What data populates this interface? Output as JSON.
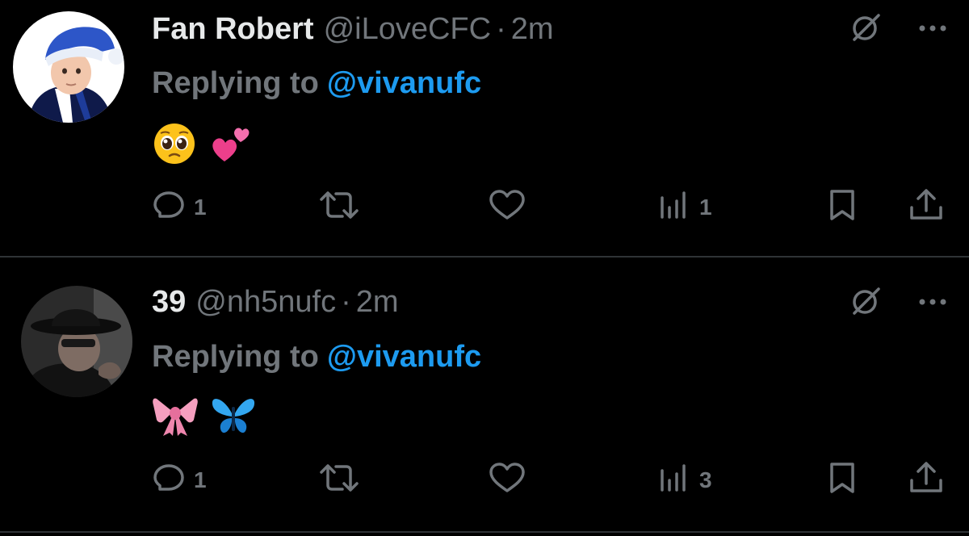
{
  "tweets": [
    {
      "display_name": "Fan Robert",
      "handle": "@iLoveCFC",
      "separator": "·",
      "time": "2m",
      "replying_label": "Replying to",
      "replying_handle": "@vivanufc",
      "emojis": [
        "🥺",
        "💕"
      ],
      "reply_count": "1",
      "view_count": "1",
      "avatar_icon": "child-in-blue-hat-avatar"
    },
    {
      "display_name": "39",
      "handle": "@nh5nufc",
      "separator": "·",
      "time": "2m",
      "replying_label": "Replying to",
      "replying_handle": "@vivanufc",
      "emojis": [
        "🎀",
        "🦋"
      ],
      "reply_count": "1",
      "view_count": "3",
      "avatar_icon": "man-in-black-hat-avatar"
    }
  ],
  "colors": {
    "background": "#000000",
    "primary_text": "#e7e9ea",
    "secondary_text": "#71767b",
    "link": "#1d9bf0",
    "divider": "#2f3336"
  }
}
